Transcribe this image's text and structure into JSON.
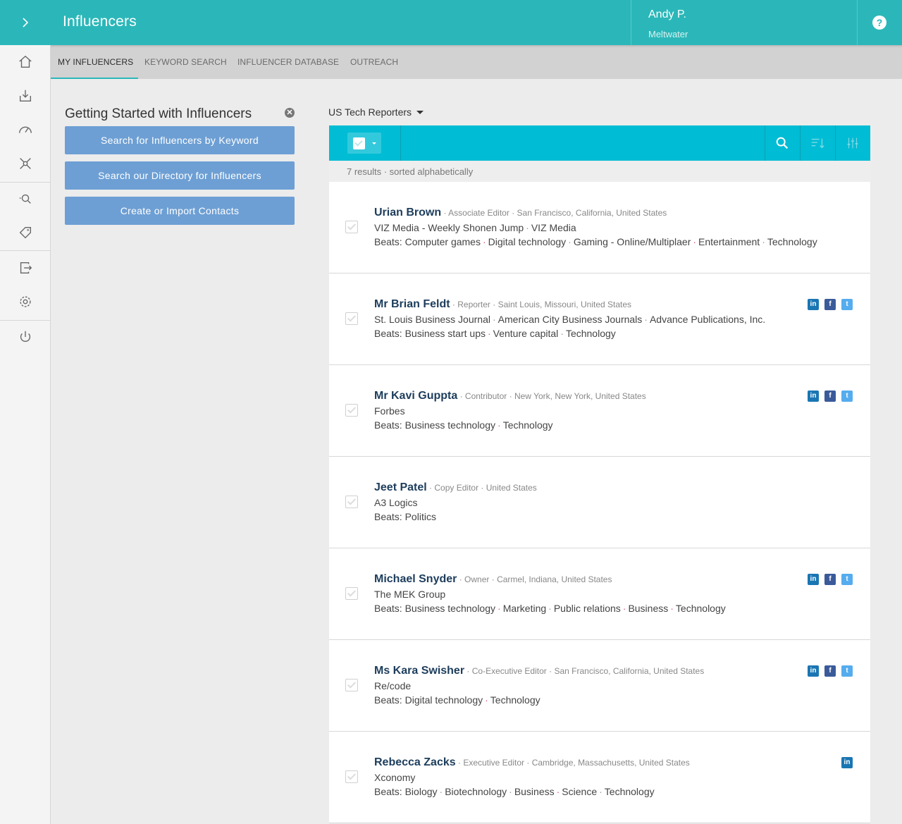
{
  "app": {
    "title": "Influencers"
  },
  "user": {
    "name": "Andy P.",
    "org": "Meltwater"
  },
  "header": {
    "help_glyph": "?"
  },
  "tabs": [
    {
      "label": "MY INFLUENCERS",
      "active": true
    },
    {
      "label": "KEYWORD SEARCH",
      "active": false
    },
    {
      "label": "INFLUENCER DATABASE",
      "active": false
    },
    {
      "label": "OUTREACH",
      "active": false
    }
  ],
  "rail": {
    "icons": [
      "home-icon",
      "inbox-icon",
      "dashboard-icon",
      "network-icon",
      "explore-icon",
      "tag-icon",
      "export-icon",
      "settings-icon",
      "power-icon"
    ]
  },
  "getting_started": {
    "title": "Getting Started with Influencers",
    "close_glyph": "✕",
    "buttons": [
      "Search for Influencers by Keyword",
      "Search our Directory for Influencers",
      "Create or Import Contacts"
    ]
  },
  "list": {
    "name": "US Tech Reporters",
    "results_text": "7 results · sorted alphabetically"
  },
  "colors": {
    "header_teal": "#2bb7b9",
    "toolbar_cyan": "#00bcd4",
    "button_blue": "#6d9fd4",
    "name_navy": "#1d3d5c",
    "beat_separator_pink": "#e05a7a"
  },
  "influencers": [
    {
      "name": "Urian Brown",
      "title": "Associate Editor",
      "location": "San Francisco, California, United States",
      "outlets": [
        "VIZ Media - Weekly Shonen Jump",
        "VIZ Media"
      ],
      "beats_label": "Beats:",
      "beats": [
        "Computer games",
        "Digital technology",
        "Gaming - Online/Multiplaer",
        "Entertainment",
        "Technology"
      ],
      "beat_seps": [
        "pink",
        "grey",
        "pink",
        "grey"
      ],
      "social": []
    },
    {
      "name": "Mr Brian Feldt",
      "title": "Reporter",
      "location": "Saint Louis, Missouri, United States",
      "outlets": [
        "St. Louis Business Journal",
        "American City Business Journals",
        "Advance Publications, Inc."
      ],
      "beats_label": "Beats:",
      "beats": [
        "Business start ups",
        "Venture capital",
        "Technology"
      ],
      "beat_seps": [
        "pink",
        "grey"
      ],
      "social": [
        "linkedin",
        "facebook",
        "twitter"
      ]
    },
    {
      "name": "Mr Kavi Guppta",
      "title": "Contributor",
      "location": "New York, New York, United States",
      "outlets": [
        "Forbes"
      ],
      "beats_label": "Beats:",
      "beats": [
        "Business technology",
        "Technology"
      ],
      "beat_seps": [
        "pink"
      ],
      "social": [
        "linkedin",
        "facebook",
        "twitter"
      ]
    },
    {
      "name": "Jeet Patel",
      "title": "Copy Editor",
      "location": "United States",
      "outlets": [
        "A3 Logics"
      ],
      "beats_label": "Beats:",
      "beats": [
        "Politics"
      ],
      "beat_seps": [],
      "social": []
    },
    {
      "name": "Michael Snyder",
      "title": "Owner",
      "location": "Carmel, Indiana, United States",
      "outlets": [
        "The MEK Group"
      ],
      "beats_label": "Beats:",
      "beats": [
        "Business technology",
        "Marketing",
        "Public relations",
        "Business",
        "Technology"
      ],
      "beat_seps": [
        "pink",
        "grey",
        "pink",
        "pink"
      ],
      "social": [
        "linkedin",
        "facebook",
        "twitter"
      ]
    },
    {
      "name": "Ms Kara Swisher",
      "title": "Co-Executive Editor",
      "location": "San Francisco, California, United States",
      "outlets": [
        "Re/code"
      ],
      "beats_label": "Beats:",
      "beats": [
        "Digital technology",
        "Technology"
      ],
      "beat_seps": [
        "pink"
      ],
      "social": [
        "linkedin",
        "facebook",
        "twitter"
      ]
    },
    {
      "name": "Rebecca Zacks",
      "title": "Executive Editor",
      "location": "Cambridge, Massachusetts, United States",
      "outlets": [
        "Xconomy"
      ],
      "beats_label": "Beats:",
      "beats": [
        "Biology",
        "Biotechnology",
        "Business",
        "Science",
        "Technology"
      ],
      "beat_seps": [
        "grey",
        "grey",
        "pink",
        "grey"
      ],
      "social": [
        "linkedin"
      ]
    }
  ]
}
